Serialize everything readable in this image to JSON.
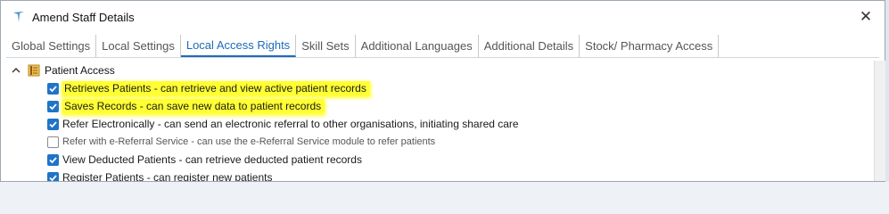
{
  "window": {
    "title": "Amend Staff Details",
    "close_glyph": "✕"
  },
  "tabs": [
    {
      "label": "Global Settings",
      "active": false
    },
    {
      "label": "Local Settings",
      "active": false
    },
    {
      "label": "Local Access Rights",
      "active": true
    },
    {
      "label": "Skill Sets",
      "active": false
    },
    {
      "label": "Additional Languages",
      "active": false
    },
    {
      "label": "Additional Details",
      "active": false
    },
    {
      "label": "Stock/ Pharmacy Access",
      "active": false
    }
  ],
  "tree": {
    "group_label": "Patient Access",
    "items": [
      {
        "label": "Retrieves Patients  -  can retrieve and view active patient records",
        "checked": true,
        "highlighted": true
      },
      {
        "label": "Saves Records  -  can save new data to patient records",
        "checked": true,
        "highlighted": true
      },
      {
        "label": "Refer Electronically  -  can send an electronic referral to other organisations, initiating shared care",
        "checked": true,
        "highlighted": false
      },
      {
        "label": "Refer with e-Referral Service  -  can use the e-Referral Service module to refer patients",
        "checked": false,
        "highlighted": false
      },
      {
        "label": "View Deducted Patients  -  can retrieve deducted patient records",
        "checked": true,
        "highlighted": false
      },
      {
        "label": "Register Patients  -  can register new patients",
        "checked": true,
        "highlighted": false
      }
    ]
  },
  "colors": {
    "accent": "#1c6bb8",
    "checkbox": "#1f74c9",
    "highlight": "#ffff33"
  }
}
